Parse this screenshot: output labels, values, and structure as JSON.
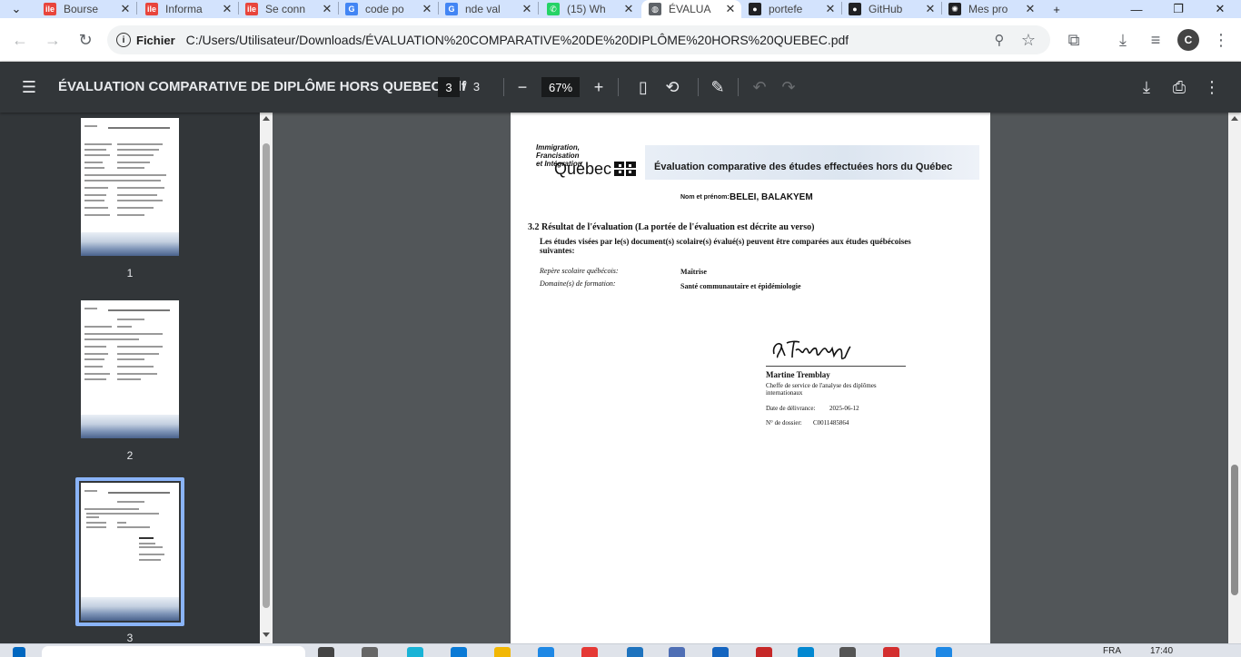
{
  "browser": {
    "tabs": [
      {
        "title": "Bourse",
        "favicon": "bourse-icon",
        "favicon_color": "#e8453c",
        "favicon_char": "ile"
      },
      {
        "title": "Informa",
        "favicon": "bourse-icon",
        "favicon_color": "#e8453c",
        "favicon_char": "ile"
      },
      {
        "title": "Se conn",
        "favicon": "bourse-icon",
        "favicon_color": "#e8453c",
        "favicon_char": "ile"
      },
      {
        "title": "code po",
        "favicon": "google-icon",
        "favicon_color": "#4285f4",
        "favicon_char": "G"
      },
      {
        "title": "nde val",
        "favicon": "google-icon",
        "favicon_color": "#4285f4",
        "favicon_char": "G"
      },
      {
        "title": "(15) Wh",
        "favicon": "whatsapp-icon",
        "favicon_color": "#25d366",
        "favicon_char": "✆"
      },
      {
        "title": "ÉVALUA",
        "favicon": "globe-icon",
        "favicon_color": "#5f6368",
        "favicon_char": "◍",
        "active": true
      },
      {
        "title": "portefe",
        "favicon": "account-icon",
        "favicon_color": "#202124",
        "favicon_char": "●"
      },
      {
        "title": "GitHub",
        "favicon": "github-icon",
        "favicon_color": "#202124",
        "favicon_char": "●"
      },
      {
        "title": "Mes pro",
        "favicon": "app-icon",
        "favicon_color": "#202124",
        "favicon_char": "✺"
      }
    ],
    "new_tab": "+",
    "address": {
      "chip_label": "Fichier",
      "url": "C:/Users/Utilisateur/Downloads/ÉVALUATION%20COMPARATIVE%20DE%20DIPLÔME%20HORS%20QUEBEC.pdf"
    },
    "profile_initial": "C"
  },
  "pdf": {
    "filename": "ÉVALUATION COMPARATIVE DE DIPLÔME HORS QUEBEC.pdf",
    "current_page": "3",
    "page_sep": "/",
    "total_pages": "3",
    "zoom": "67%",
    "thumbnails": [
      {
        "label": "1"
      },
      {
        "label": "2"
      },
      {
        "label": "3",
        "selected": true
      }
    ],
    "document": {
      "logo_line1": "Immigration,",
      "logo_line2": "Francisation",
      "logo_line3": "et Intégration",
      "logo_quebec": "Québec",
      "banner_title": "Évaluation comparative des études effectuées hors du Québec",
      "name_label": "Nom et prénom:",
      "name_value": "BELEI, BALAKYEM",
      "section_title": "3.2 Résultat de l'évaluation (La portée de l'évaluation est décrite au verso)",
      "section_text1": "Les études visées par le(s) document(s) scolaire(s) évalué(s) peuvent être comparées aux études québécoises",
      "section_text2": "suivantes:",
      "repere_label": "Repère scolaire québécois:",
      "repere_value": "Maîtrise",
      "domaine_label": "Domaine(s) de formation:",
      "domaine_value": "Santé communautaire et épidémiologie",
      "signer_name": "Martine Tremblay",
      "signer_title1": "Cheffe de service de l'analyse des diplômes",
      "signer_title2": "internationaux",
      "date_label": "Date de délivrance:",
      "date_value": "2025-06-12",
      "dossier_label": "N° de dossier:",
      "dossier_value": "C0011485864"
    }
  },
  "taskbar": {
    "language": "FRA",
    "time": "17:40"
  }
}
